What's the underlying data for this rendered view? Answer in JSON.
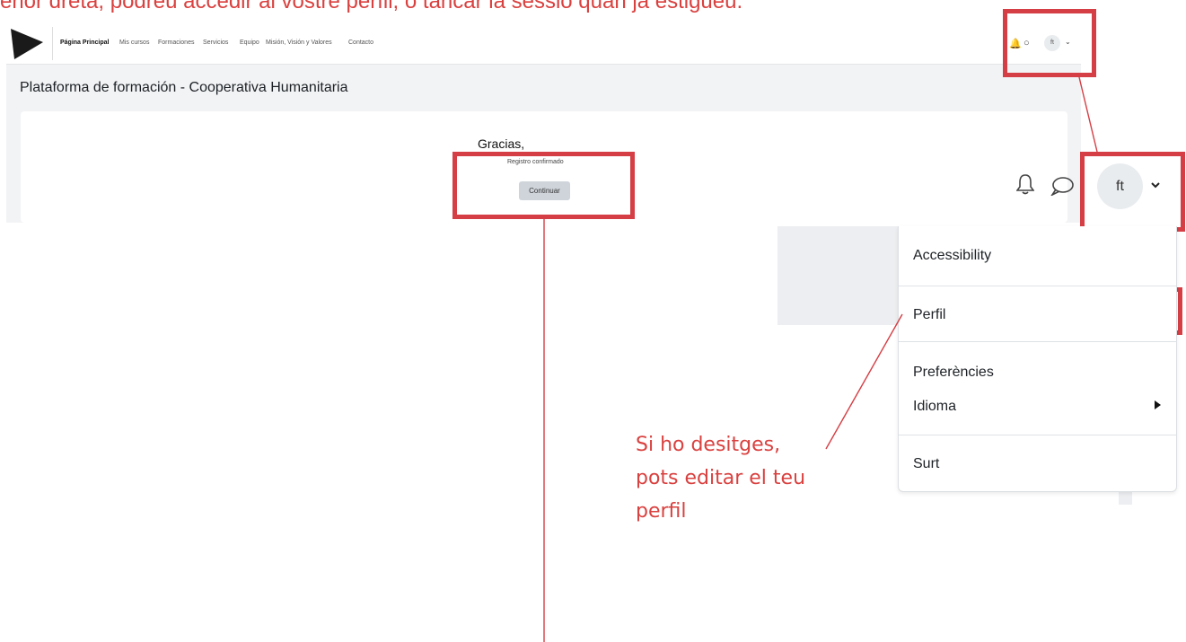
{
  "annotations": {
    "top_caption": "erior dreta, podreu accedir al vostre perfil, o tancar la sessió quan ja estigueu.",
    "profile_hint": [
      "Si ho desitges,",
      "pots editar el teu",
      "perfil"
    ]
  },
  "nav": {
    "items": [
      "Página Principal",
      "Mis cursos",
      "Formaciones",
      "Servicios",
      "Equipo",
      "Misión, Visión y Valores",
      "Contacto"
    ],
    "user_initials_small": "ft"
  },
  "page": {
    "title": "Plataforma de formación - Cooperativa Humanitaria",
    "message_title": "Gracias,",
    "message_body": "Registro confirmado",
    "continue_label": "Continuar"
  },
  "user_menu": {
    "initials": "ft",
    "items": [
      "Accessibility",
      "Perfil",
      "Preferències",
      "Idioma",
      "Surt"
    ]
  },
  "colors": {
    "annotation": "#d9413f",
    "highlight": "#d53e44"
  },
  "icons": [
    "bell-icon",
    "chat-icon",
    "chevron-down-icon",
    "caret-right-icon",
    "logo-icon"
  ]
}
